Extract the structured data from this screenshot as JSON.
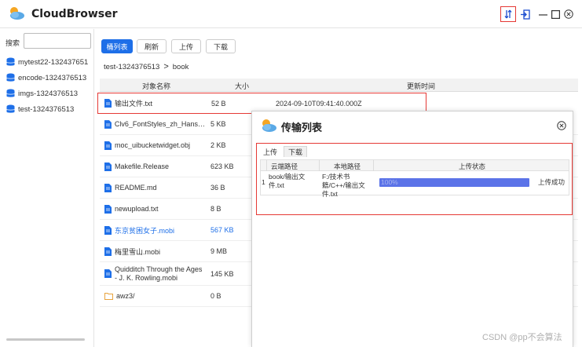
{
  "app": {
    "title": "CloudBrowser"
  },
  "sidebar": {
    "search_label": "搜索",
    "search_value": "",
    "buckets": [
      {
        "label": "mytest22-132437651"
      },
      {
        "label": "encode-1324376513"
      },
      {
        "label": "imgs-1324376513"
      },
      {
        "label": "test-1324376513"
      }
    ]
  },
  "toolbar": {
    "flat_list": "桶列表",
    "refresh": "刷新",
    "upload": "上传",
    "download": "下载"
  },
  "breadcrumb": {
    "bucket": "test-1324376513",
    "separator": ">",
    "folder": "book"
  },
  "file_table": {
    "headers": {
      "name": "对象名称",
      "size": "大小",
      "time": "更新时间"
    },
    "rows": [
      {
        "name": "输出文件.txt",
        "size": "52 B",
        "time": "2024-09-10T09:41:40.000Z",
        "type": "file"
      },
      {
        "name": "Clv6_FontStyles_zh_Hans_...",
        "size": "5 KB",
        "time": "",
        "type": "file"
      },
      {
        "name": "moc_uibucketwidget.obj",
        "size": "2 KB",
        "time": "",
        "type": "file"
      },
      {
        "name": "Makefile.Release",
        "size": "623 KB",
        "time": "",
        "type": "file"
      },
      {
        "name": "README.md",
        "size": "36 B",
        "time": "",
        "type": "file"
      },
      {
        "name": "newupload.txt",
        "size": "8 B",
        "time": "",
        "type": "file"
      },
      {
        "name": "东京贫困女子.mobi",
        "size": "567 KB",
        "time": "",
        "type": "file"
      },
      {
        "name": "梅里雪山.mobi",
        "size": "9 MB",
        "time": "",
        "type": "file"
      },
      {
        "name": "Quidditch Through the Ages - J. K. Rowling.mobi",
        "size": "145 KB",
        "time": "",
        "type": "file"
      },
      {
        "name": "awz3/",
        "size": "0 B",
        "time": "",
        "type": "folder"
      }
    ]
  },
  "dialog": {
    "title": "传输列表",
    "tabs": {
      "upload": "上传",
      "download": "下载"
    },
    "headers": {
      "cloud_path": "云端路径",
      "local_path": "本地路径",
      "status": "上传状态"
    },
    "rows": [
      {
        "index": "1",
        "cloud_path": "book/输出文件.txt",
        "local_path": "F:/技术书籍/C++/输出文件.txt",
        "progress_label": "100%",
        "progress": 1.0,
        "status": "上传成功"
      }
    ]
  },
  "watermark": "CSDN @pp不会算法",
  "colors": {
    "accent": "#1e6fe8",
    "highlight_border": "#e53935",
    "progress": "#5b73e8"
  }
}
